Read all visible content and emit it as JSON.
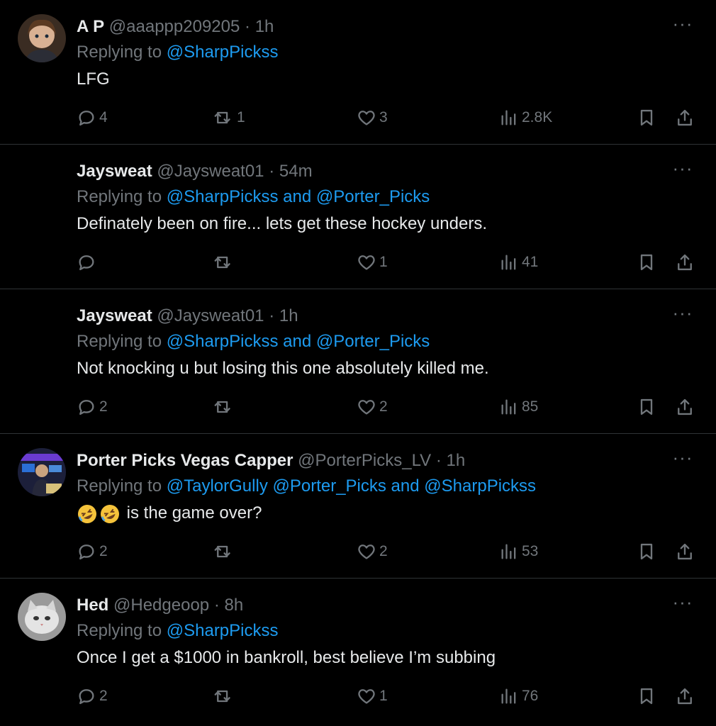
{
  "tweets": [
    {
      "name": "A P",
      "handle": "@aaappp209205",
      "separator": "·",
      "time": "1h",
      "replying_prefix": "Replying to ",
      "mentions": [
        "@SharpPickss"
      ],
      "connectors": [],
      "text": "LFG",
      "emoji_count": 0,
      "reply_count": "4",
      "retweet_count": "1",
      "like_count": "3",
      "view_count": "2.8K",
      "avatar_style": "anime-portrait"
    },
    {
      "name": "Jaysweat",
      "handle": "@Jaysweat01",
      "separator": "·",
      "time": "54m",
      "replying_prefix": "Replying to ",
      "mentions": [
        "@SharpPickss",
        "@Porter_Picks"
      ],
      "connectors": [
        " and "
      ],
      "text": "Definately been on fire... lets get these hockey unders.",
      "emoji_count": 0,
      "reply_count": "",
      "retweet_count": "",
      "like_count": "1",
      "view_count": "41",
      "avatar_style": "none"
    },
    {
      "name": "Jaysweat",
      "handle": "@Jaysweat01",
      "separator": "·",
      "time": "1h",
      "replying_prefix": "Replying to ",
      "mentions": [
        "@SharpPickss",
        "@Porter_Picks"
      ],
      "connectors": [
        " and "
      ],
      "text": "Not knocking u but losing this one absolutely killed me.",
      "emoji_count": 0,
      "reply_count": "2",
      "retweet_count": "",
      "like_count": "2",
      "view_count": "85",
      "avatar_style": "none"
    },
    {
      "name": "Porter Picks Vegas Capper",
      "handle": "@PorterPicks_LV",
      "separator": "·",
      "time": "1h",
      "replying_prefix": "Replying to ",
      "mentions": [
        "@TaylorGully",
        "@Porter_Picks",
        "@SharpPickss"
      ],
      "connectors": [
        " ",
        " and "
      ],
      "text": "is the game over?",
      "emoji_count": 2,
      "emoji_name": "rolling-on-floor-laughing",
      "reply_count": "2",
      "retweet_count": "",
      "like_count": "2",
      "view_count": "53",
      "avatar_style": "studio-photo"
    },
    {
      "name": "Hed",
      "handle": "@Hedgeoop",
      "separator": "·",
      "time": "8h",
      "replying_prefix": "Replying to ",
      "mentions": [
        "@SharpPickss"
      ],
      "connectors": [],
      "text": "Once I get a $1000 in bankroll, best believe I’m subbing",
      "emoji_count": 0,
      "reply_count": "2",
      "retweet_count": "",
      "like_count": "1",
      "view_count": "76",
      "avatar_style": "cat-photo"
    }
  ],
  "more_label": "···",
  "icons": {
    "reply": "reply-icon",
    "retweet": "retweet-icon",
    "like": "heart-icon",
    "views": "views-icon",
    "bookmark": "bookmark-icon",
    "share": "share-icon",
    "more": "more-icon"
  },
  "colors": {
    "background": "#000000",
    "text": "#e7e9ea",
    "muted": "#71767b",
    "link": "#1d9bf0",
    "divider": "#2f3336"
  }
}
